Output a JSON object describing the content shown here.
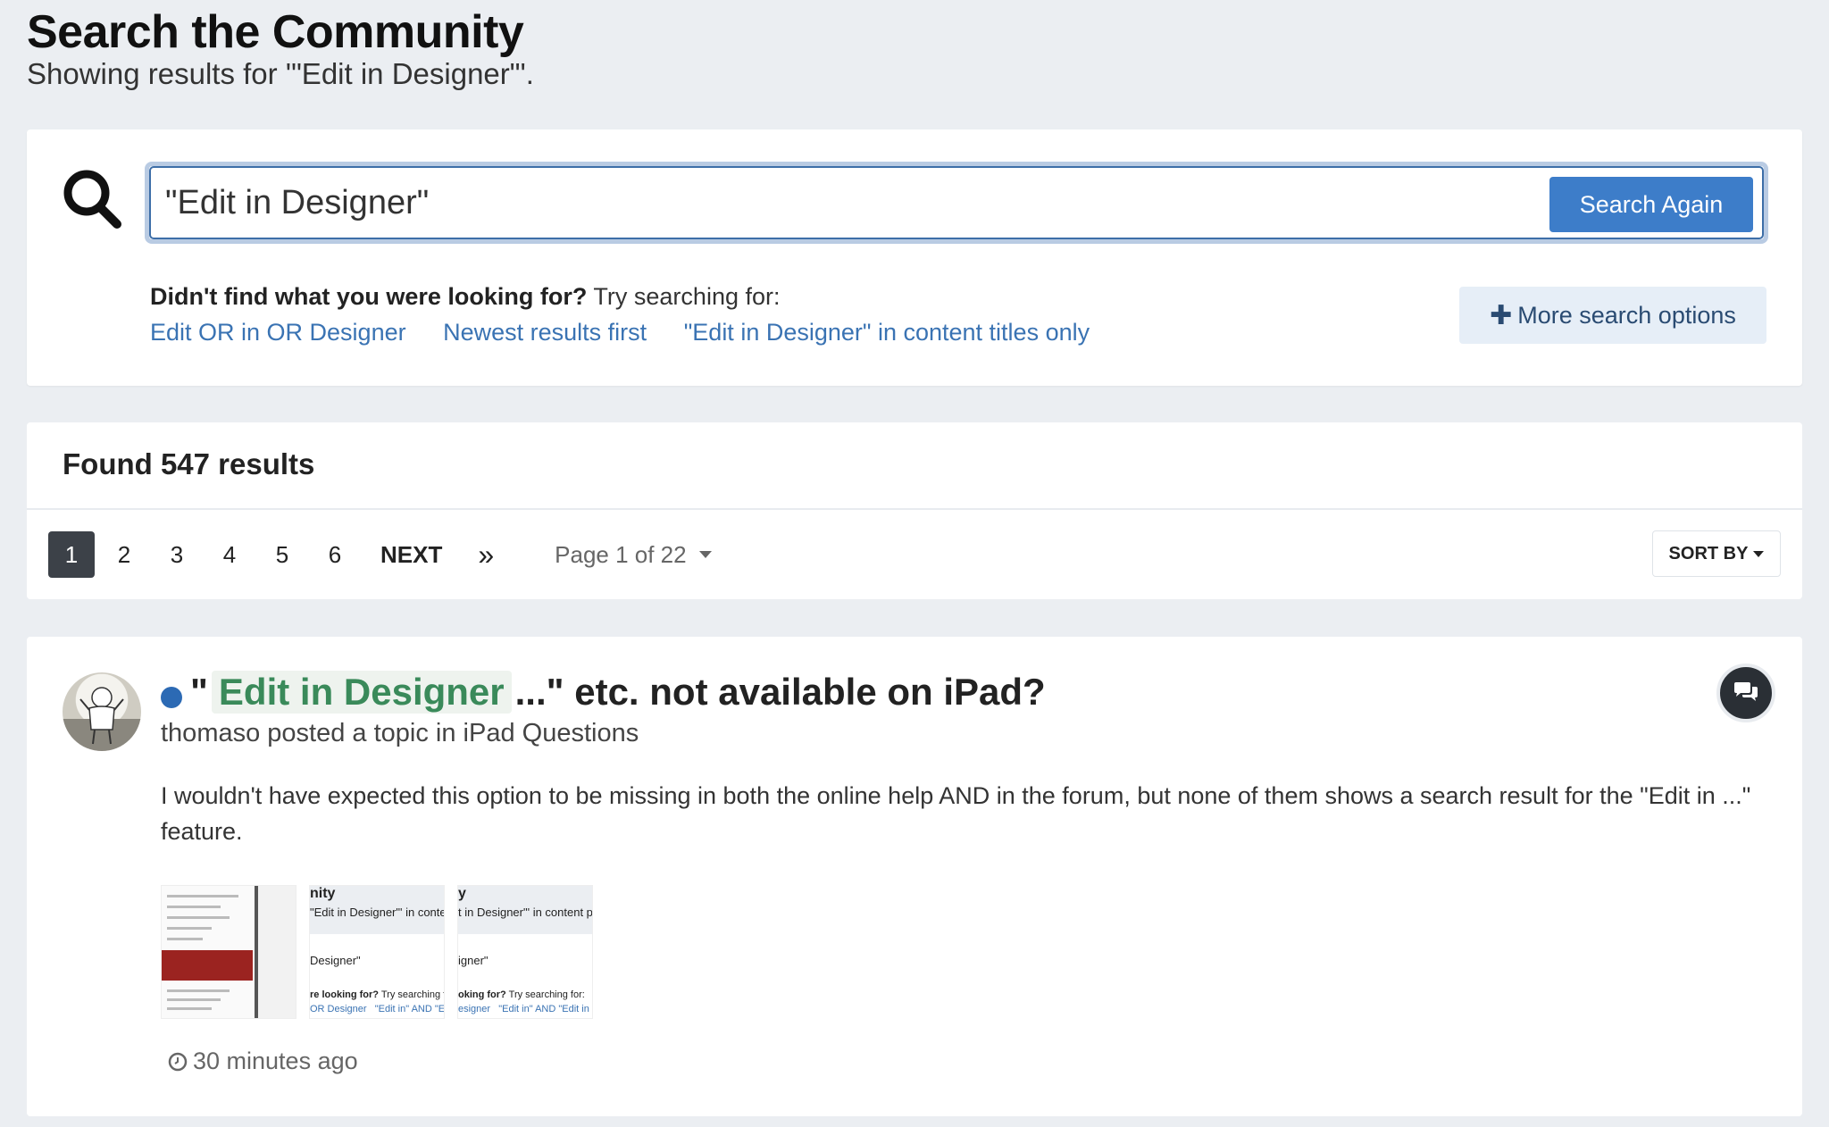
{
  "header": {
    "title": "Search the Community",
    "subtitle": "Showing results for '\"Edit in Designer\"'."
  },
  "search": {
    "query": "\"Edit in Designer\"",
    "button_label": "Search Again",
    "suggest_bold": "Didn't find what you were looking for?",
    "suggest_rest": " Try searching for:",
    "suggestions": [
      "Edit OR in OR Designer",
      "Newest results first",
      "\"Edit in Designer\" in content titles only"
    ],
    "more_options_label": "More search options"
  },
  "results": {
    "count_label": "Found 547 results",
    "pages": [
      "1",
      "2",
      "3",
      "4",
      "5",
      "6"
    ],
    "active_page": "1",
    "next_label": "NEXT",
    "last_label": "»",
    "page_jump_label": "Page 1 of 22",
    "sort_label": "SORT BY"
  },
  "result_item": {
    "title_prefix": "\"",
    "title_highlight": "Edit in Designer",
    "title_suffix": "...\" etc. not available on iPad?",
    "meta": "thomaso posted a topic in iPad Questions",
    "snippet": "I wouldn't have expected this option to be missing in both the online help AND in the forum, but none of them shows a search result for the \"Edit in ...\" feature.",
    "timestamp": "30 minutes ago",
    "thumb2": {
      "head": "nity",
      "line1": "\"Edit in Designer\"' in conte",
      "line2": "Designer\"",
      "line3_bold": "re looking for?",
      "line3_rest": " Try searching for:",
      "line4a": "OR Designer",
      "line4b": "\"Edit in\" AND \"Ed"
    },
    "thumb3": {
      "head": "y",
      "line1": "t in Designer\"' in content p",
      "line2": "igner\"",
      "line3_bold": "oking for?",
      "line3_rest": " Try searching for:",
      "line4a": "esigner",
      "line4b": "\"Edit in\" AND \"Edit in"
    }
  },
  "colors": {
    "accent": "#3d7dc9",
    "link": "#3a73b3",
    "highlight_text": "#3a8a5a",
    "unread_dot": "#2c6ab4"
  }
}
